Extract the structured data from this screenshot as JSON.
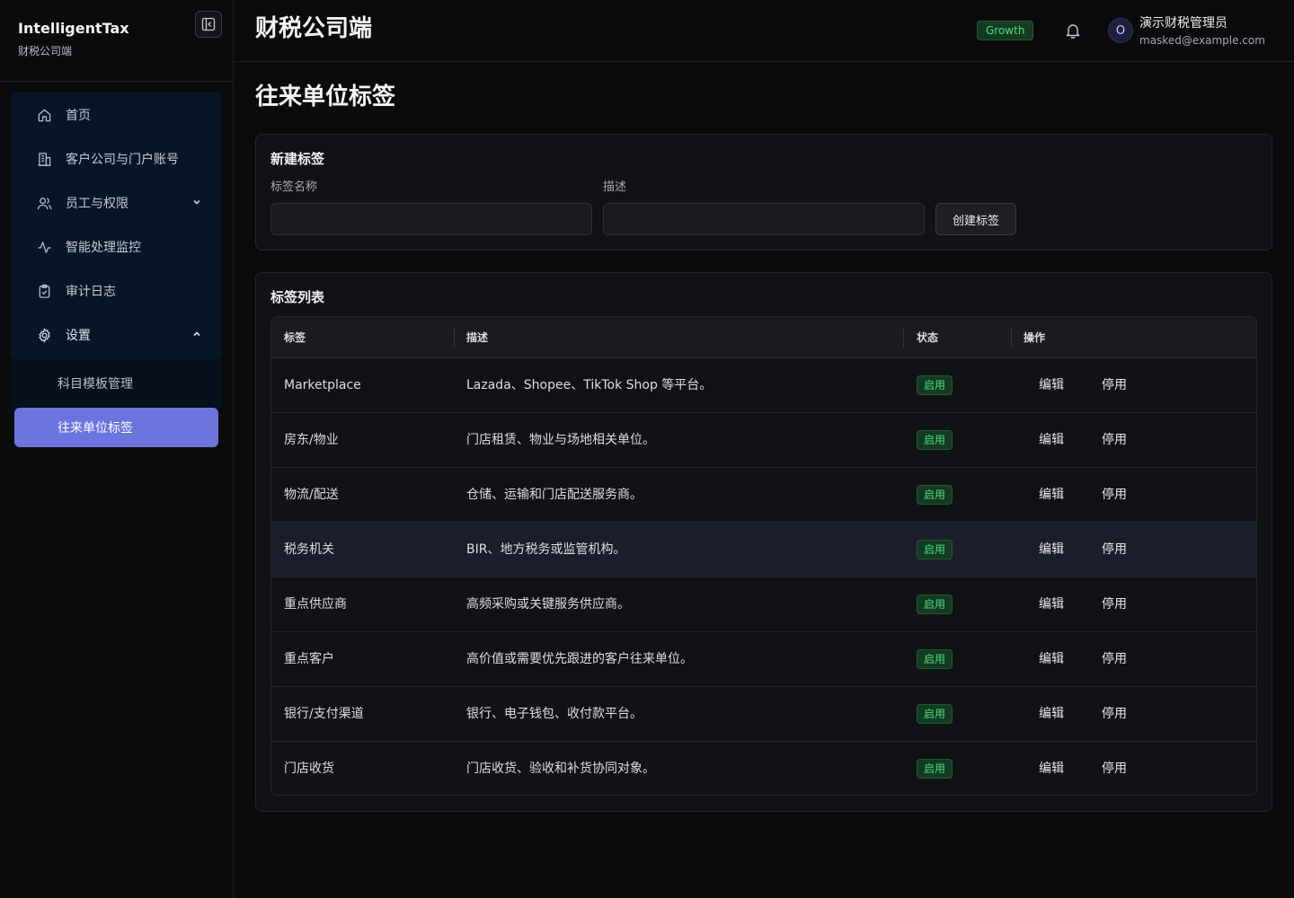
{
  "sidebar": {
    "brand_title": "IntelligentTax",
    "brand_subtitle": "财税公司端",
    "items": [
      {
        "label": "首页",
        "icon": "home-icon"
      },
      {
        "label": "客户公司与门户账号",
        "icon": "building-icon"
      },
      {
        "label": "员工与权限",
        "icon": "users-icon"
      },
      {
        "label": "智能处理监控",
        "icon": "activity-icon"
      },
      {
        "label": "审计日志",
        "icon": "clipboard-icon"
      },
      {
        "label": "设置",
        "icon": "gear-icon"
      }
    ],
    "sub_items": [
      {
        "label": "科目模板管理",
        "active": false
      },
      {
        "label": "往来单位标签",
        "active": true
      }
    ]
  },
  "header": {
    "title": "财税公司端",
    "plan_badge": "Growth",
    "avatar_initial": "O",
    "user_name": "演示财税管理员",
    "user_email": "masked@example.com"
  },
  "page": {
    "title": "往来单位标签"
  },
  "new_tag": {
    "card_title": "新建标签",
    "name_label": "标签名称",
    "name_value": "",
    "desc_label": "描述",
    "desc_value": "",
    "create_button": "创建标签"
  },
  "tag_list": {
    "card_title": "标签列表",
    "columns": [
      "标签",
      "描述",
      "状态",
      "操作"
    ],
    "edit_label": "编辑",
    "disable_label": "停用",
    "rows": [
      {
        "tag": "Marketplace",
        "desc": "Lazada、Shopee、TikTok Shop 等平台。",
        "status": "启用"
      },
      {
        "tag": "房东/物业",
        "desc": "门店租赁、物业与场地相关单位。",
        "status": "启用"
      },
      {
        "tag": "物流/配送",
        "desc": "仓储、运输和门店配送服务商。",
        "status": "启用"
      },
      {
        "tag": "税务机关",
        "desc": "BIR、地方税务或监管机构。",
        "status": "启用"
      },
      {
        "tag": "重点供应商",
        "desc": "高频采购或关键服务供应商。",
        "status": "启用"
      },
      {
        "tag": "重点客户",
        "desc": "高价值或需要优先跟进的客户往来单位。",
        "status": "启用"
      },
      {
        "tag": "银行/支付渠道",
        "desc": "银行、电子钱包、收付款平台。",
        "status": "启用"
      },
      {
        "tag": "门店收货",
        "desc": "门店收货、验收和补货协同对象。",
        "status": "启用"
      }
    ]
  },
  "colors": {
    "accent": "#6c74dd",
    "success": "#4ade80",
    "nav_background": "#061627",
    "background": "#0b0b0d"
  }
}
